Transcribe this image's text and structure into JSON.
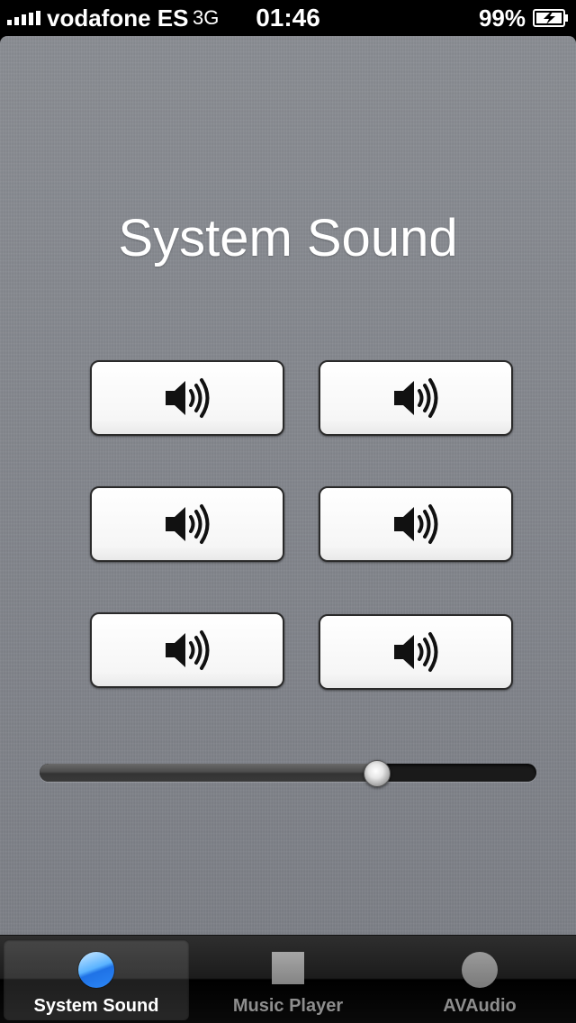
{
  "status_bar": {
    "carrier": "vodafone ES",
    "network": "3G",
    "time": "01:46",
    "battery_percent": "99%",
    "battery_level": 0.99,
    "battery_charging": true,
    "signal_bars": 5
  },
  "main": {
    "title": "System Sound",
    "sound_buttons": [
      {
        "icon": "speaker-icon"
      },
      {
        "icon": "speaker-icon"
      },
      {
        "icon": "speaker-icon"
      },
      {
        "icon": "speaker-icon"
      },
      {
        "icon": "speaker-icon"
      },
      {
        "icon": "speaker-icon"
      }
    ],
    "volume_slider": {
      "value": 0.68
    }
  },
  "tab_bar": {
    "tabs": [
      {
        "label": "System Sound",
        "icon": "blue-circle-icon",
        "selected": true
      },
      {
        "label": "Music Player",
        "icon": "square-icon",
        "selected": false
      },
      {
        "label": "AVAudio",
        "icon": "circle-icon",
        "selected": false
      }
    ]
  },
  "colors": {
    "background": "#84878d",
    "tab_bar": "#1c1c1c",
    "accent_blue": "#2b86f5",
    "selected_tab_label": "#ffffff",
    "unselected_tab_label": "#8e8e8e"
  }
}
